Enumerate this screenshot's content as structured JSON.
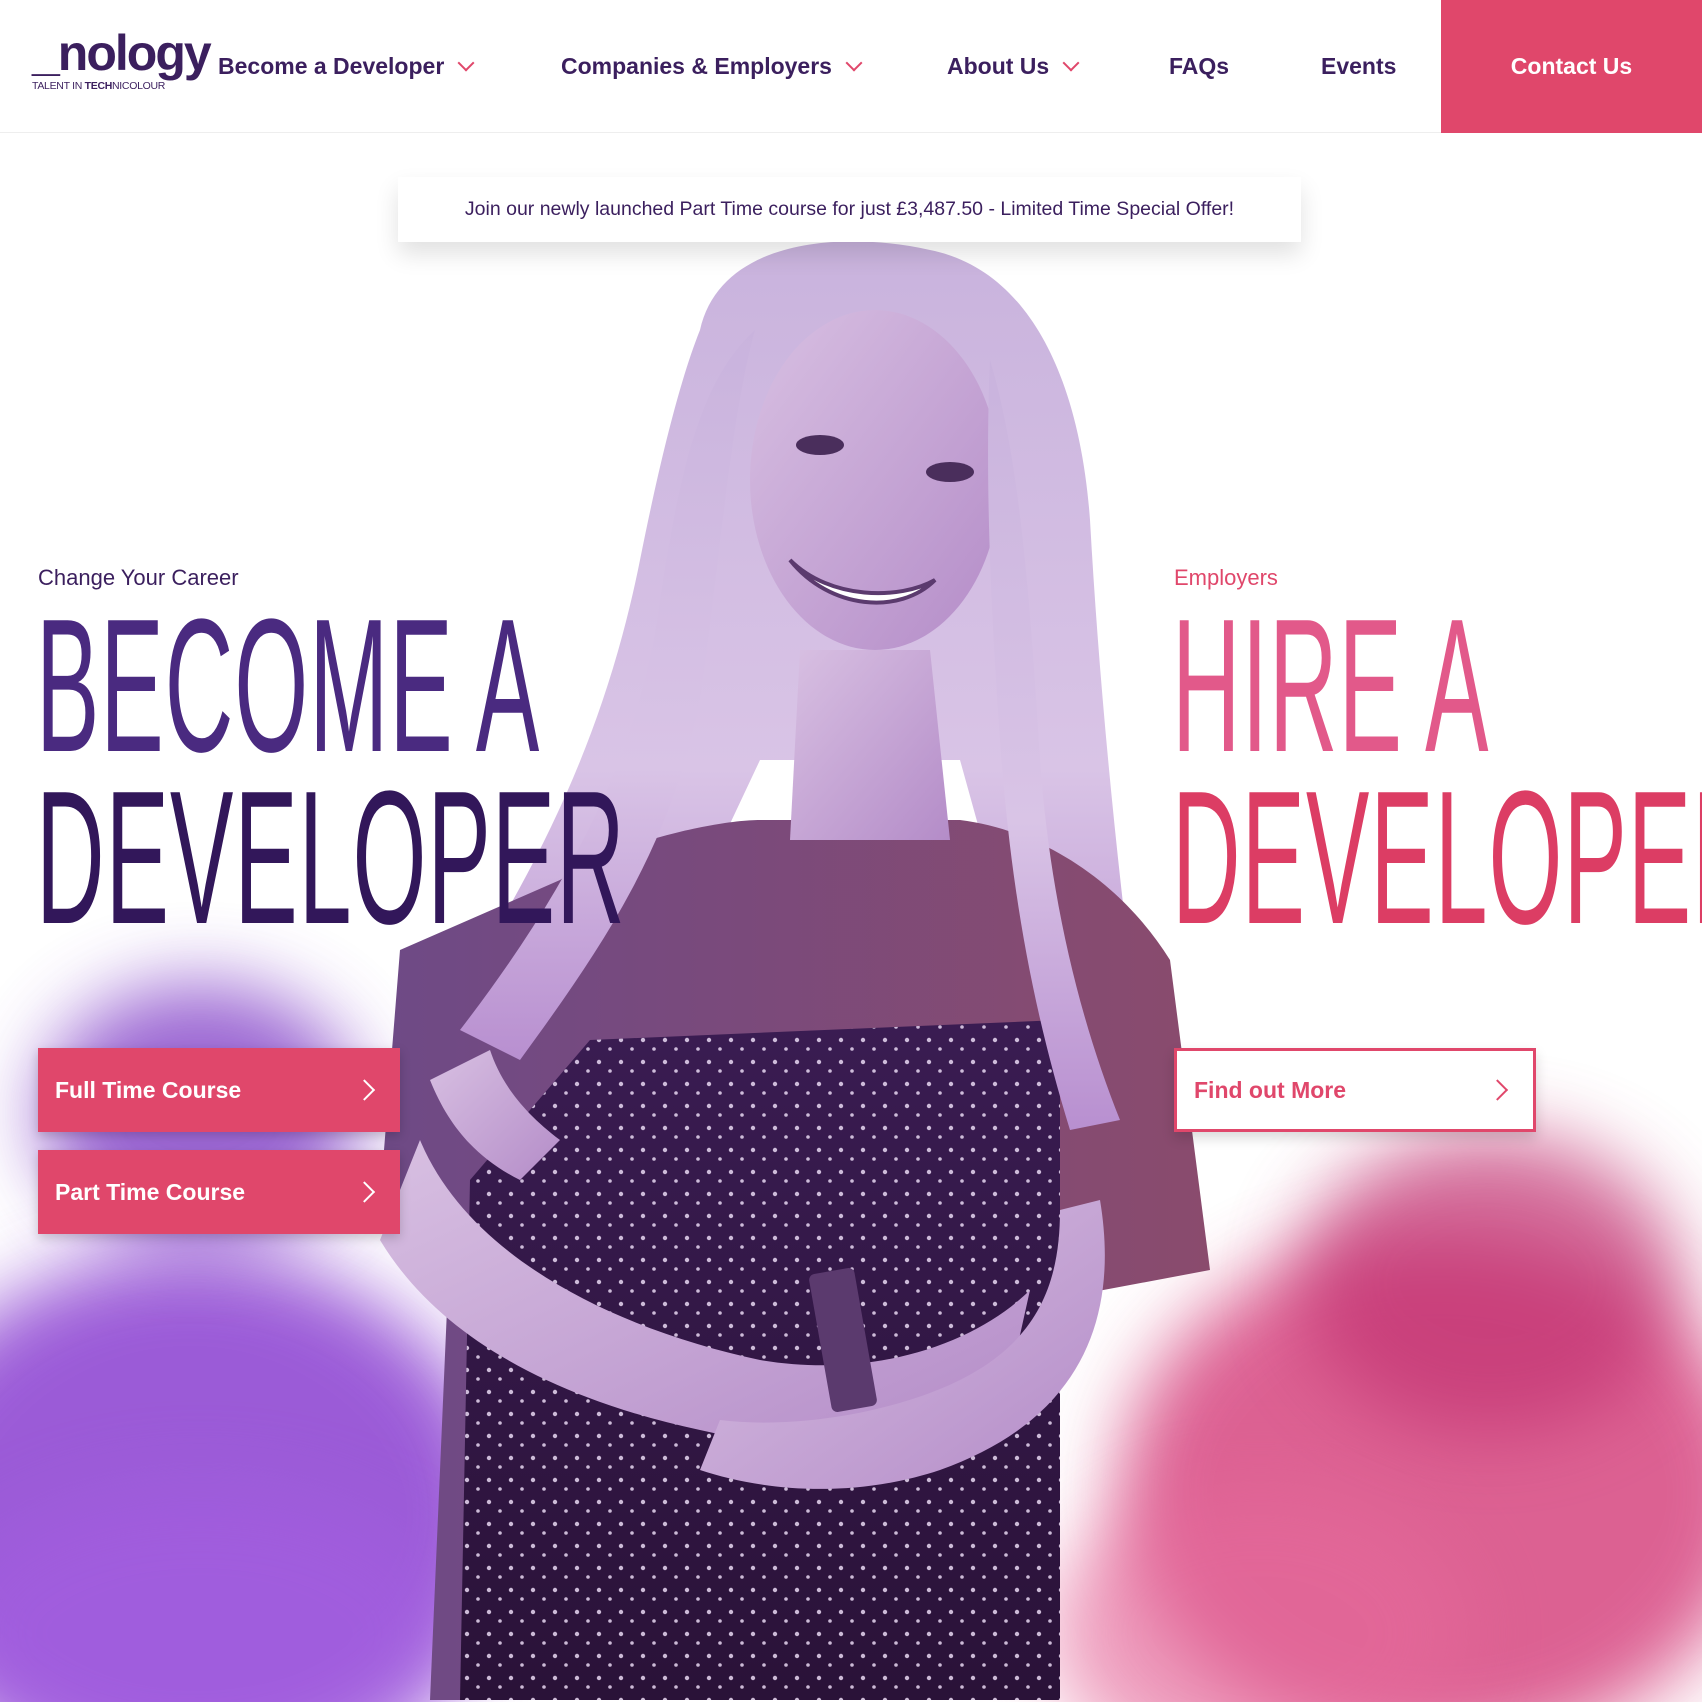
{
  "logo": {
    "word": "_nology",
    "tagline_pre": "TALENT IN ",
    "tagline_bold": "TECH",
    "tagline_post": "NICOLOUR"
  },
  "nav": {
    "items": [
      {
        "label": "Become a Developer"
      },
      {
        "label": "Companies & Employers"
      },
      {
        "label": "About Us"
      },
      {
        "label": "FAQs"
      },
      {
        "label": "Events"
      }
    ],
    "contact_label": "Contact Us"
  },
  "banner": {
    "text": "Join our newly launched Part Time course for just £3,487.50 - Limited Time Special Offer!"
  },
  "left": {
    "eyebrow": "Change Your Career",
    "headline_line1": "BECOME A",
    "headline_line2": "DEVELOPER",
    "buttons": [
      {
        "label": "Full Time Course"
      },
      {
        "label": "Part Time Course"
      }
    ]
  },
  "right": {
    "eyebrow": "Employers",
    "headline_line1": "HIRE A",
    "headline_line2": "DEVELOPER",
    "button": {
      "label": "Find out More"
    }
  },
  "colors": {
    "brand_purple": "#3b1f5e",
    "brand_pink": "#e0476b",
    "smoke_purple": "#8a3fd1",
    "smoke_pink": "#d43a78"
  },
  "icons": {
    "nav_dropdown": "chevron-down-icon",
    "button_arrow": "chevron-right-icon"
  }
}
